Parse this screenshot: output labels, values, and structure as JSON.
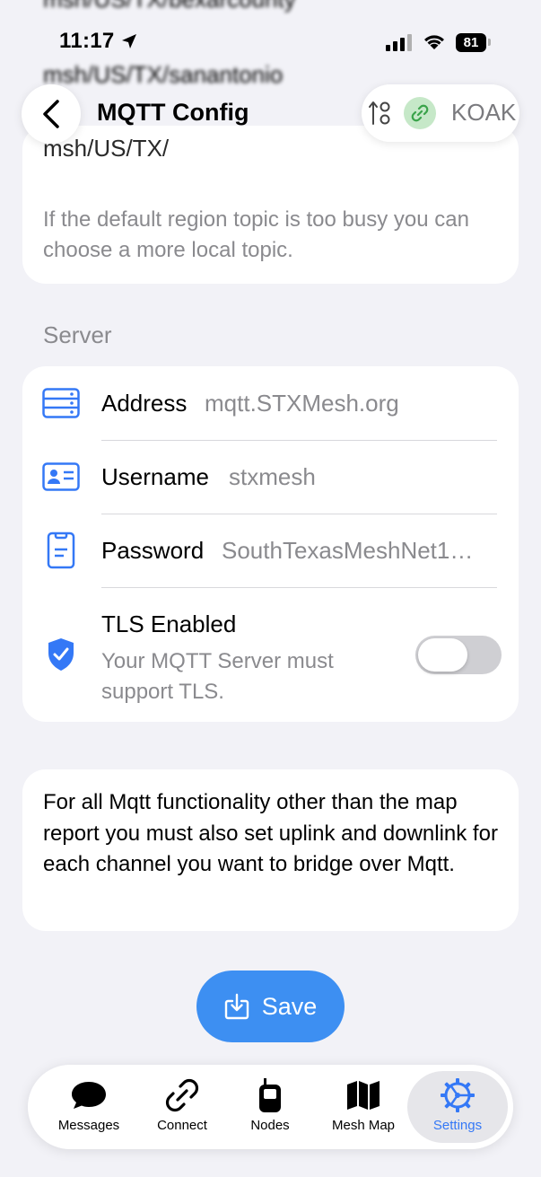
{
  "status_bar": {
    "time": "11:17",
    "battery": "81"
  },
  "header": {
    "title": "MQTT Config",
    "node_short_name": "KOAK"
  },
  "topic_section": {
    "previous_topics": [
      "msh/US/TX/bexarcounty",
      "msh/US/TX/sanantonio"
    ],
    "current_topic": "msh/US/TX/",
    "footer": "If the default region topic is too busy you can choose a more local topic."
  },
  "server": {
    "header": "Server",
    "address_label": "Address",
    "address_value": "mqtt.STXMesh.org",
    "username_label": "Username",
    "username_value": "stxmesh",
    "password_label": "Password",
    "password_value": "SouthTexasMeshNet1…",
    "tls_label": "TLS Enabled",
    "tls_subtitle": "Your MQTT Server must support TLS.",
    "tls_enabled": false
  },
  "info": {
    "text": "For all Mqtt functionality other than the map report you must also set uplink and downlink for each channel you want to bridge over Mqtt."
  },
  "save_button": {
    "label": "Save"
  },
  "tabs": [
    {
      "label": "Messages",
      "icon": "message-bubble-icon"
    },
    {
      "label": "Connect",
      "icon": "link-icon"
    },
    {
      "label": "Nodes",
      "icon": "radio-device-icon"
    },
    {
      "label": "Mesh Map",
      "icon": "map-icon"
    },
    {
      "label": "Settings",
      "icon": "gear-icon",
      "active": true
    }
  ],
  "colors": {
    "accent": "#3478f6",
    "save_button": "#3d8ff2",
    "background": "#f2f2f7"
  }
}
